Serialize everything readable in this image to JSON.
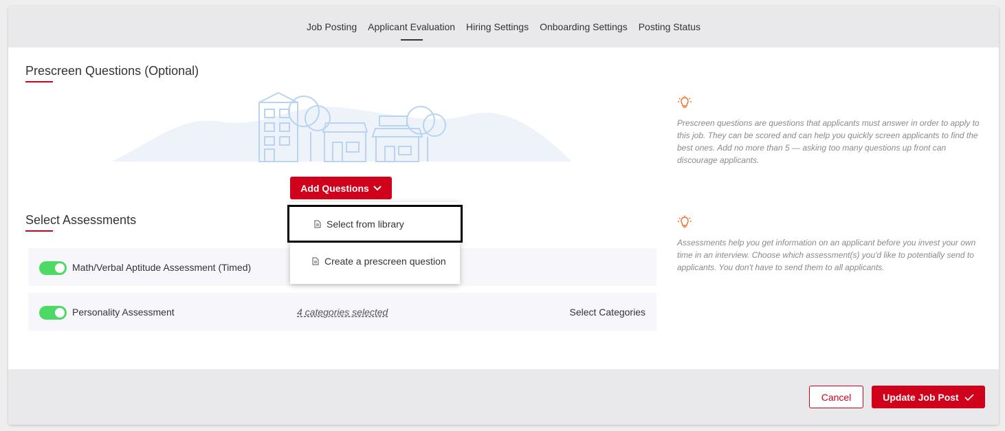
{
  "tabs": [
    {
      "label": "Job Posting"
    },
    {
      "label": "Applicant Evaluation"
    },
    {
      "label": "Hiring Settings"
    },
    {
      "label": "Onboarding Settings"
    },
    {
      "label": "Posting Status"
    }
  ],
  "prescreen": {
    "title": "Prescreen Questions (Optional)",
    "add_button_label": "Add Questions",
    "hint": "Prescreen questions are questions that applicants must answer in order to apply to this job. They can be scored and can help you quickly screen applicants to find the best ones. Add no more than 5 — asking too many questions up front can discourage applicants."
  },
  "dropdown": {
    "items": [
      {
        "label": "Select from library"
      },
      {
        "label": "Create a prescreen question"
      }
    ]
  },
  "assessments": {
    "title": "Select Assessments",
    "hint": "Assessments help you get information on an applicant before you invest your own time in an interview. Choose which assessment(s) you'd like to potentially send to applicants. You don't have to send them to all applicants.",
    "rows": [
      {
        "label": "Math/Verbal Aptitude Assessment (Timed)"
      },
      {
        "label": "Personality Assessment",
        "categories": "4 categories selected",
        "action": "Select Categories"
      }
    ]
  },
  "footer": {
    "cancel_label": "Cancel",
    "update_label": "Update Job Post"
  },
  "colors": {
    "accent": "#d0021b",
    "toggle_on": "#4cd964",
    "hint_icon": "#f26b21"
  }
}
